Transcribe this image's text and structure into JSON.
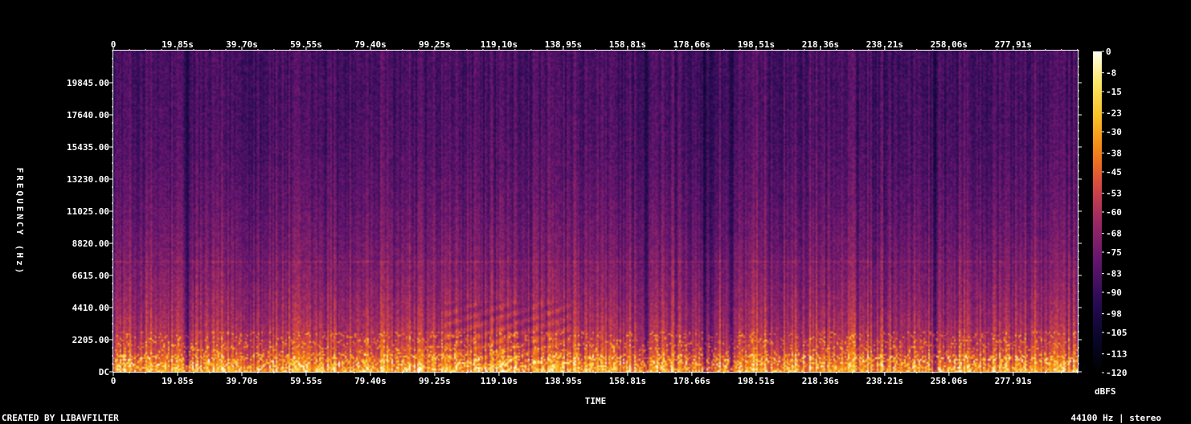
{
  "chart_data": {
    "type": "heatmap",
    "xlabel": "TIME",
    "ylabel": "FREQUENCY (Hz)",
    "x_ticks": [
      "0",
      "19.85s",
      "39.70s",
      "59.55s",
      "79.40s",
      "99.25s",
      "119.10s",
      "138.95s",
      "158.81s",
      "178.66s",
      "198.51s",
      "218.36s",
      "238.21s",
      "258.06s",
      "277.91s"
    ],
    "x_tick_values": [
      0,
      19.85,
      39.7,
      59.55,
      79.4,
      99.25,
      119.1,
      138.95,
      158.81,
      178.66,
      198.51,
      218.36,
      238.21,
      258.06,
      277.91
    ],
    "xlim": [
      0,
      297.8
    ],
    "y_ticks": [
      "DC",
      "2205.00",
      "4410.00",
      "6615.00",
      "8820.00",
      "11025.00",
      "13230.00",
      "15435.00",
      "17640.00",
      "19845.00"
    ],
    "y_tick_values": [
      0,
      2205,
      4410,
      6615,
      8820,
      11025,
      13230,
      15435,
      17640,
      19845
    ],
    "ylim": [
      0,
      22050
    ],
    "colorbar": {
      "unit": "dBFS",
      "ticks": [
        "0",
        "-8",
        "-15",
        "-23",
        "-30",
        "-38",
        "-45",
        "-53",
        "-60",
        "-68",
        "-75",
        "-83",
        "-90",
        "-98",
        "-105",
        "-113",
        "-120"
      ],
      "tick_values": [
        0,
        -8,
        -15,
        -23,
        -30,
        -38,
        -45,
        -53,
        -60,
        -68,
        -75,
        -83,
        -90,
        -98,
        -105,
        -113,
        -120
      ],
      "range": [
        -120,
        0
      ]
    },
    "grid": false,
    "quiet_gaps_s": [
      22.5,
      164.5,
      182.5,
      184.5,
      190.5,
      253.5
    ]
  },
  "footer": {
    "left": "CREATED BY LIBAVFILTER",
    "right": "44100 Hz | stereo"
  }
}
